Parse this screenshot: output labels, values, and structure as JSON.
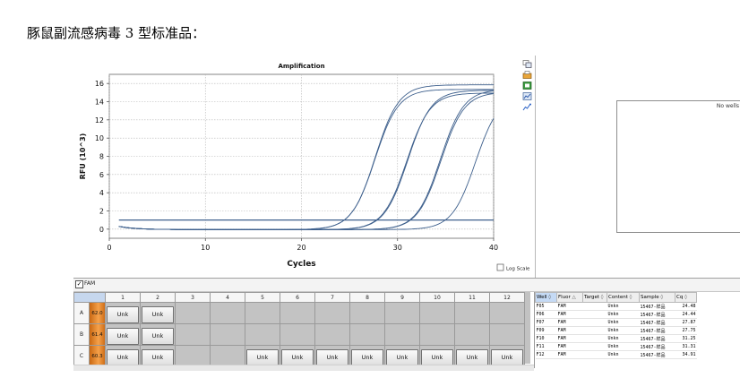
{
  "heading": "豚鼠副流感病毒 3 型标准品：",
  "chart": {
    "title": "Amplification",
    "xlabel": "Cycles",
    "ylabel": "RFU (10^3)",
    "log_scale_label": "Log Scale",
    "log_scale_checked": false
  },
  "chart_data": {
    "type": "line",
    "title": "Amplification",
    "xlabel": "Cycles",
    "ylabel": "RFU (10^3)",
    "xlim": [
      0,
      40
    ],
    "ylim": [
      -1,
      17
    ],
    "xticks": [
      0,
      10,
      20,
      30,
      40
    ],
    "yticks": [
      0,
      2,
      4,
      6,
      8,
      10,
      12,
      14,
      16
    ],
    "grid": true,
    "line_color": "#3d5f8c",
    "threshold": 1.0,
    "series": [
      {
        "cq": 24.48,
        "plateau": 15.9
      },
      {
        "cq": 24.44,
        "plateau": 15.4
      },
      {
        "cq": 27.87,
        "plateau": 15.3
      },
      {
        "cq": 27.75,
        "plateau": 15.0
      },
      {
        "cq": 31.25,
        "plateau": 15.4
      },
      {
        "cq": 31.31,
        "plateau": 15.1
      },
      {
        "cq": 34.91,
        "plateau": 14.8
      }
    ]
  },
  "right_panel": {
    "no_wells_text": "No wells"
  },
  "fam_label": "FAM",
  "plate": {
    "columns": [
      "1",
      "2",
      "3",
      "4",
      "5",
      "6",
      "7",
      "8",
      "9",
      "10",
      "11",
      "12"
    ],
    "rows": [
      {
        "label": "A",
        "temp": "62.0",
        "cells": [
          "Unk",
          "Unk",
          "",
          "",
          "",
          "",
          "",
          "",
          "",
          "",
          "",
          ""
        ]
      },
      {
        "label": "B",
        "temp": "61.4",
        "cells": [
          "Unk",
          "Unk",
          "",
          "",
          "",
          "",
          "",
          "",
          "",
          "",
          "",
          ""
        ]
      },
      {
        "label": "C",
        "temp": "60.3",
        "cells": [
          "Unk",
          "Unk",
          "",
          "",
          "Unk",
          "Unk",
          "Unk",
          "Unk",
          "Unk",
          "Unk",
          "Unk",
          "Unk"
        ]
      }
    ]
  },
  "wells_table": {
    "headers": [
      "Well",
      "Fluor",
      "Target",
      "Content",
      "Sample",
      "Cq"
    ],
    "rows": [
      [
        "F05",
        "FAM",
        "",
        "Unkn",
        "15467-样品",
        "24.48"
      ],
      [
        "F06",
        "FAM",
        "",
        "Unkn",
        "15467-样品",
        "24.44"
      ],
      [
        "F07",
        "FAM",
        "",
        "Unkn",
        "15467-样品",
        "27.87"
      ],
      [
        "F09",
        "FAM",
        "",
        "Unkn",
        "15467-样品",
        "27.75"
      ],
      [
        "F10",
        "FAM",
        "",
        "Unkn",
        "15467-样品",
        "31.25"
      ],
      [
        "F11",
        "FAM",
        "",
        "Unkn",
        "15467-样品",
        "31.31"
      ],
      [
        "F12",
        "FAM",
        "",
        "Unkn",
        "15467-样品",
        "34.91"
      ]
    ]
  },
  "toolbar_icons": [
    "copy-icon",
    "export-icon",
    "image-icon",
    "chart-icon",
    "settings-icon"
  ]
}
